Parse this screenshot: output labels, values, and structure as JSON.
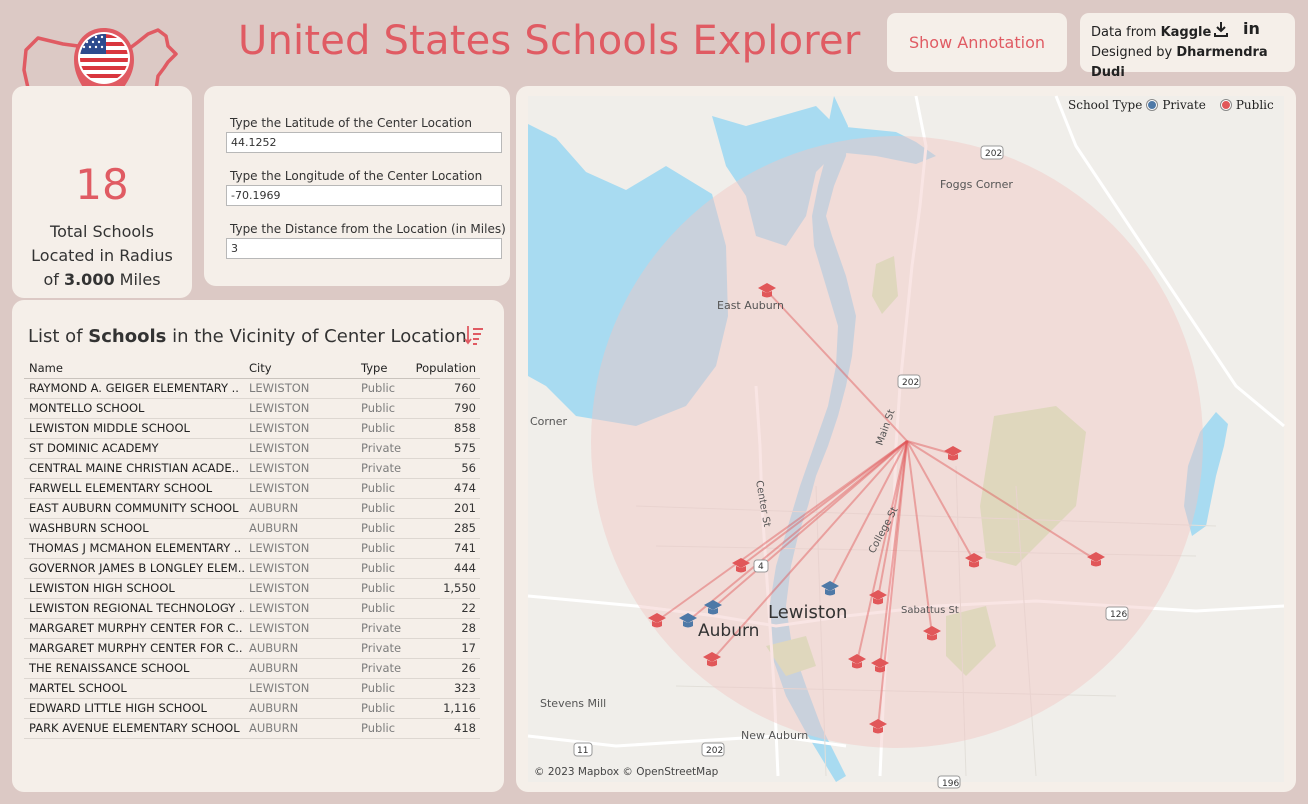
{
  "header": {
    "title": "United States Schools Explorer",
    "annotation_button": "Show Annotation",
    "credits_line1_prefix": "Data from ",
    "credits_line1_bold": "Kaggle",
    "credits_line2_prefix": "Designed by ",
    "credits_line2_bold": "Dharmendra Dudi"
  },
  "summary": {
    "count": "18",
    "line1": "Total Schools",
    "line2": "Located in Radius",
    "line3_prefix": "of ",
    "line3_bold": "3.000",
    "line3_suffix": " Miles"
  },
  "inputs": {
    "lat_label": "Type the Latitude of the Center Location",
    "lat_value": "44.1252",
    "lon_label": "Type the Longitude of the Center Location",
    "lon_value": "-70.1969",
    "dist_label": "Type the Distance from the Location (in Miles)",
    "dist_value": "3"
  },
  "list": {
    "title_prefix": "List of ",
    "title_bold": "Schools",
    "title_suffix": " in the Vicinity of Center Location",
    "columns": [
      "Name",
      "City",
      "Type",
      "Population"
    ],
    "rows": [
      [
        "RAYMOND A. GEIGER ELEMENTARY ..",
        "LEWISTON",
        "Public",
        "760"
      ],
      [
        "MONTELLO SCHOOL",
        "LEWISTON",
        "Public",
        "790"
      ],
      [
        "LEWISTON MIDDLE SCHOOL",
        "LEWISTON",
        "Public",
        "858"
      ],
      [
        "ST DOMINIC ACADEMY",
        "LEWISTON",
        "Private",
        "575"
      ],
      [
        "CENTRAL MAINE CHRISTIAN ACADE..",
        "LEWISTON",
        "Private",
        "56"
      ],
      [
        "FARWELL ELEMENTARY SCHOOL",
        "LEWISTON",
        "Public",
        "474"
      ],
      [
        "EAST AUBURN COMMUNITY SCHOOL",
        "AUBURN",
        "Public",
        "201"
      ],
      [
        "WASHBURN SCHOOL",
        "AUBURN",
        "Public",
        "285"
      ],
      [
        "THOMAS J MCMAHON ELEMENTARY ..",
        "LEWISTON",
        "Public",
        "741"
      ],
      [
        "GOVERNOR JAMES B LONGLEY ELEM..",
        "LEWISTON",
        "Public",
        "444"
      ],
      [
        "LEWISTON HIGH SCHOOL",
        "LEWISTON",
        "Public",
        "1,550"
      ],
      [
        "LEWISTON REGIONAL TECHNOLOGY ..",
        "LEWISTON",
        "Public",
        "22"
      ],
      [
        "MARGARET MURPHY CENTER FOR C..",
        "LEWISTON",
        "Private",
        "28"
      ],
      [
        "MARGARET MURPHY CENTER FOR C..",
        "AUBURN",
        "Private",
        "17"
      ],
      [
        "THE RENAISSANCE SCHOOL",
        "AUBURN",
        "Private",
        "26"
      ],
      [
        "MARTEL SCHOOL",
        "LEWISTON",
        "Public",
        "323"
      ],
      [
        "EDWARD LITTLE HIGH SCHOOL",
        "AUBURN",
        "Public",
        "1,116"
      ],
      [
        "PARK AVENUE ELEMENTARY SCHOOL",
        "AUBURN",
        "Public",
        "418"
      ]
    ]
  },
  "map": {
    "legend_title": "School Type",
    "legend_private": "Private",
    "legend_public": "Public",
    "color_private": "#4e79a7",
    "color_public": "#e15759",
    "copyright": "© 2023 Mapbox  © OpenStreetMap",
    "place_labels": [
      "Foggs Corner",
      "East Auburn",
      "Corner",
      "Lewiston",
      "Auburn",
      "Stevens Mill",
      "New Auburn",
      "Main St",
      "Center St",
      "College St",
      "Sabattus St"
    ],
    "road_shields": [
      "202",
      "202",
      "126",
      "11",
      "202",
      "4",
      "196"
    ]
  }
}
